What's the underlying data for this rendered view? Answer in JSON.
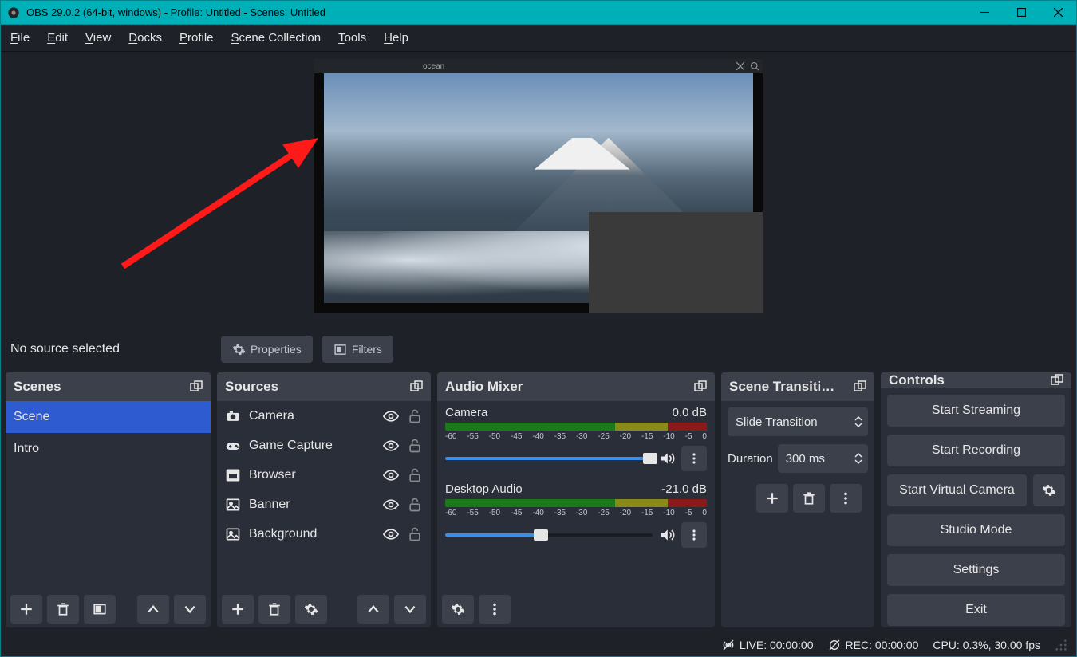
{
  "window": {
    "title": "OBS 29.0.2 (64-bit, windows) - Profile: Untitled - Scenes: Untitled"
  },
  "menu": {
    "file": "File",
    "edit": "Edit",
    "view": "View",
    "docks": "Docks",
    "profile": "Profile",
    "scene_collection": "Scene Collection",
    "tools": "Tools",
    "help": "Help"
  },
  "preview": {
    "mini_label": "ocean"
  },
  "source_info": {
    "no_source": "No source selected",
    "properties": "Properties",
    "filters": "Filters"
  },
  "docks": {
    "scenes": {
      "title": "Scenes",
      "items": [
        "Scene",
        "Intro"
      ],
      "selected": 0
    },
    "sources": {
      "title": "Sources",
      "items": [
        {
          "icon": "camera",
          "label": "Camera"
        },
        {
          "icon": "gamepad",
          "label": "Game Capture"
        },
        {
          "icon": "browser",
          "label": "Browser"
        },
        {
          "icon": "image",
          "label": "Banner"
        },
        {
          "icon": "image",
          "label": "Background"
        }
      ]
    },
    "mixer": {
      "title": "Audio Mixer",
      "channels": [
        {
          "name": "Camera",
          "level": "0.0 dB",
          "slider_pct": 99
        },
        {
          "name": "Desktop Audio",
          "level": "-21.0 dB",
          "slider_pct": 46
        }
      ],
      "ticks": [
        "-60",
        "-55",
        "-50",
        "-45",
        "-40",
        "-35",
        "-30",
        "-25",
        "-20",
        "-15",
        "-10",
        "-5",
        "0"
      ]
    },
    "transitions": {
      "title": "Scene Transiti…",
      "selected": "Slide Transition",
      "duration_label": "Duration",
      "duration_value": "300 ms"
    },
    "controls": {
      "title": "Controls",
      "start_streaming": "Start Streaming",
      "start_recording": "Start Recording",
      "start_vcam": "Start Virtual Camera",
      "studio_mode": "Studio Mode",
      "settings": "Settings",
      "exit": "Exit"
    }
  },
  "status": {
    "live": "LIVE: 00:00:00",
    "rec": "REC: 00:00:00",
    "cpu": "CPU: 0.3%, 30.00 fps"
  }
}
